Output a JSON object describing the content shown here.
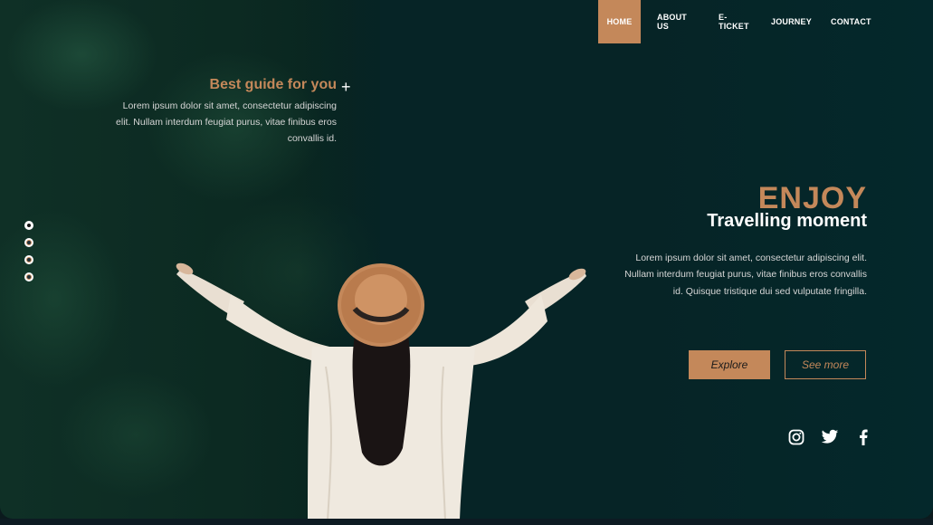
{
  "nav": {
    "items": [
      {
        "label": "HOME",
        "active": true
      },
      {
        "label": "ABOUT US",
        "active": false
      },
      {
        "label": "E-TICKET",
        "active": false
      },
      {
        "label": "JOURNEY",
        "active": false
      },
      {
        "label": "CONTACT",
        "active": false
      }
    ]
  },
  "intro": {
    "title": "Best guide for you",
    "body": "Lorem ipsum dolor sit amet, consectetur adipiscing elit. Nullam interdum feugiat purus, vitae finibus eros convallis id."
  },
  "slider": {
    "count": 4,
    "active_index": 0
  },
  "hero": {
    "headline": "ENJOY",
    "subheadline": "Travelling moment",
    "body": "Lorem ipsum dolor sit amet, consectetur adipiscing elit. Nullam interdum feugiat purus, vitae finibus eros convallis id. Quisque tristique dui sed vulputate fringilla.",
    "primary_button": "Explore",
    "secondary_button": "See more"
  },
  "social": [
    "instagram-icon",
    "twitter-icon",
    "facebook-icon"
  ],
  "colors": {
    "accent": "#c4885a",
    "background": "#062426",
    "text": "#ffffff"
  }
}
